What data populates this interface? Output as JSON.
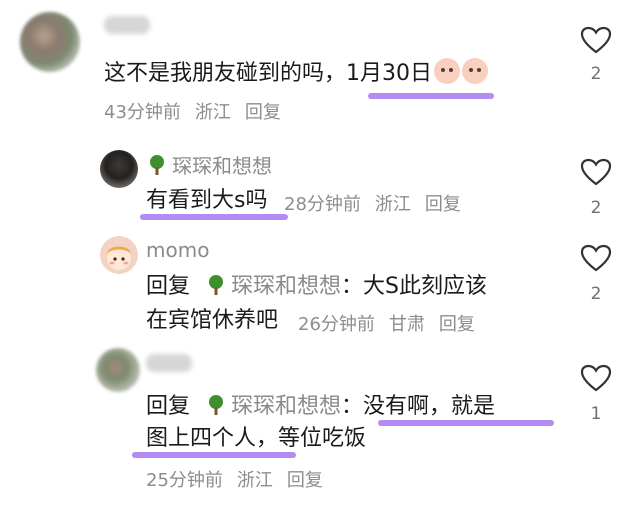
{
  "comments": [
    {
      "username": "",
      "text": "这不是我朋友碰到的吗，1月30日",
      "emoji_icons": [
        "crying-face-icon",
        "crying-face-icon"
      ],
      "meta": {
        "time": "43分钟前",
        "location": "浙江",
        "reply": "回复"
      },
      "likes": "2"
    },
    {
      "username": "琛琛和想想",
      "text": "有看到大s吗",
      "meta": {
        "time": "28分钟前",
        "location": "浙江",
        "reply": "回复"
      },
      "likes": "2"
    },
    {
      "username": "momo",
      "reply_prefix": "回复",
      "reply_to": "琛琛和想想",
      "text_line1": "：大S此刻应该",
      "text_line2": "在宾馆休养吧",
      "meta": {
        "time": "26分钟前",
        "location": "甘肃",
        "reply": "回复"
      },
      "likes": "2"
    },
    {
      "username": "",
      "reply_prefix": "回复",
      "reply_to": "琛琛和想想",
      "text_line1": "：没有啊，就是",
      "text_line2": "图上四个人，等位吃饭",
      "meta": {
        "time": "25分钟前",
        "location": "浙江",
        "reply": "回复"
      },
      "likes": "1"
    }
  ],
  "colors": {
    "highlight": "#b28cf2",
    "meta_gray": "#8d8d8d",
    "tree_green": "#3f8f2e"
  }
}
